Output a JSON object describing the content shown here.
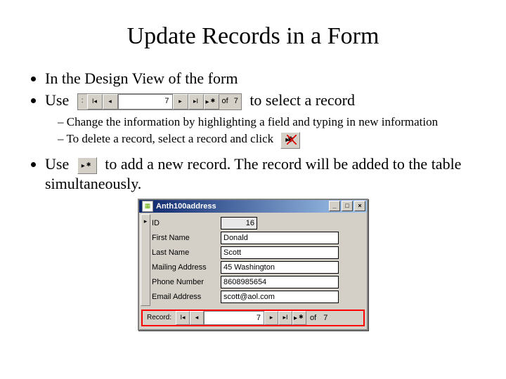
{
  "title": "Update Records in a Form",
  "bullets": {
    "b1": "In the Design View of the form",
    "b2_pre": "Use",
    "b2_post": "to select a record",
    "sub1": "Change the information by highlighting a field and typing in new information",
    "sub2_pre": "To delete a record, select a record and click",
    "b3_pre": "Use",
    "b3_post": "to add a new record.  The record will be added to the table simultaneously."
  },
  "recnav": {
    "label_colon": ":",
    "first": "I◂",
    "prev": "◂",
    "current": "7",
    "next": "▸",
    "last": "▸I",
    "new": "",
    "of_label": "of",
    "total": "7"
  },
  "form": {
    "window_title": "Anth100address",
    "selector_glyph": "▸",
    "fields": {
      "id": {
        "label": "ID",
        "value": "16"
      },
      "first": {
        "label": "First Name",
        "value": "Donald"
      },
      "last": {
        "label": "Last Name",
        "value": "Scott"
      },
      "addr": {
        "label": "Mailing Address",
        "value": "45 Washington"
      },
      "phone": {
        "label": "Phone Number",
        "value": "8608985654"
      },
      "email": {
        "label": "Email Address",
        "value": "scott@aol.com"
      }
    },
    "recordbar": {
      "label": "Record:",
      "first": "I◂",
      "prev": "◂",
      "current": "7",
      "next": "▸",
      "last": "▸I",
      "new": "",
      "of_label": "of",
      "total": "7"
    },
    "winbuttons": {
      "min": "_",
      "max": "□",
      "close": "×"
    }
  }
}
